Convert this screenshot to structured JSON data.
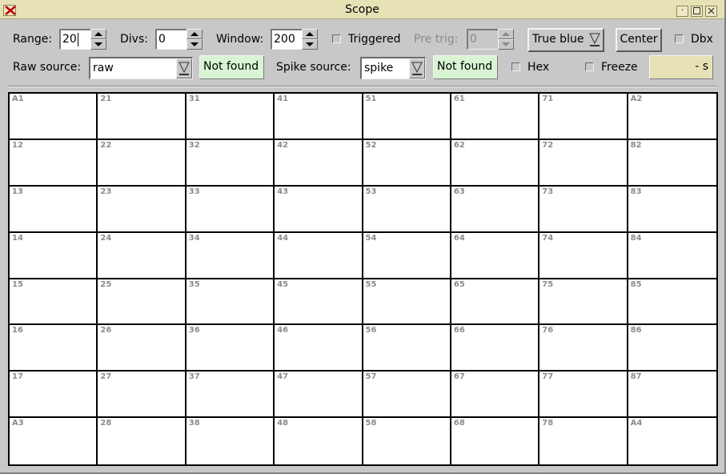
{
  "window": {
    "title": "Scope"
  },
  "controls": {
    "range": {
      "label": "Range:",
      "value": "20"
    },
    "divs": {
      "label": "Divs:",
      "value": "0"
    },
    "window": {
      "label": "Window:",
      "value": "200"
    },
    "triggered": {
      "label": "Triggered",
      "checked": false
    },
    "pretrig": {
      "label": "Pre trig:",
      "value": "0",
      "enabled": false
    },
    "color_menu": {
      "label": "True blue"
    },
    "center_button": {
      "label": "Center"
    },
    "dbx": {
      "label": "Dbx",
      "checked": false
    },
    "raw_source": {
      "label": "Raw source:",
      "value": "raw",
      "status": "Not found"
    },
    "spike_source": {
      "label": "Spike source:",
      "value": "spike",
      "status": "Not found"
    },
    "hex": {
      "label": "Hex",
      "checked": false
    },
    "freeze": {
      "label": "Freeze",
      "checked": false
    },
    "time_display": "- s"
  },
  "channels": [
    [
      "A1",
      "21",
      "31",
      "41",
      "51",
      "61",
      "71",
      "A2"
    ],
    [
      "12",
      "22",
      "32",
      "42",
      "52",
      "62",
      "72",
      "82"
    ],
    [
      "13",
      "23",
      "33",
      "43",
      "53",
      "63",
      "73",
      "83"
    ],
    [
      "14",
      "24",
      "34",
      "44",
      "54",
      "64",
      "74",
      "84"
    ],
    [
      "15",
      "25",
      "35",
      "45",
      "55",
      "65",
      "75",
      "85"
    ],
    [
      "16",
      "26",
      "36",
      "46",
      "56",
      "66",
      "76",
      "86"
    ],
    [
      "17",
      "27",
      "37",
      "47",
      "57",
      "67",
      "77",
      "87"
    ],
    [
      "A3",
      "28",
      "38",
      "48",
      "58",
      "68",
      "78",
      "A4"
    ]
  ],
  "colors": {
    "titlebar": "#e6e2b6",
    "status_ok_bg": "#d8f4d2",
    "panel": "#c8c8c8",
    "channel_label": "#8c8c8c"
  }
}
